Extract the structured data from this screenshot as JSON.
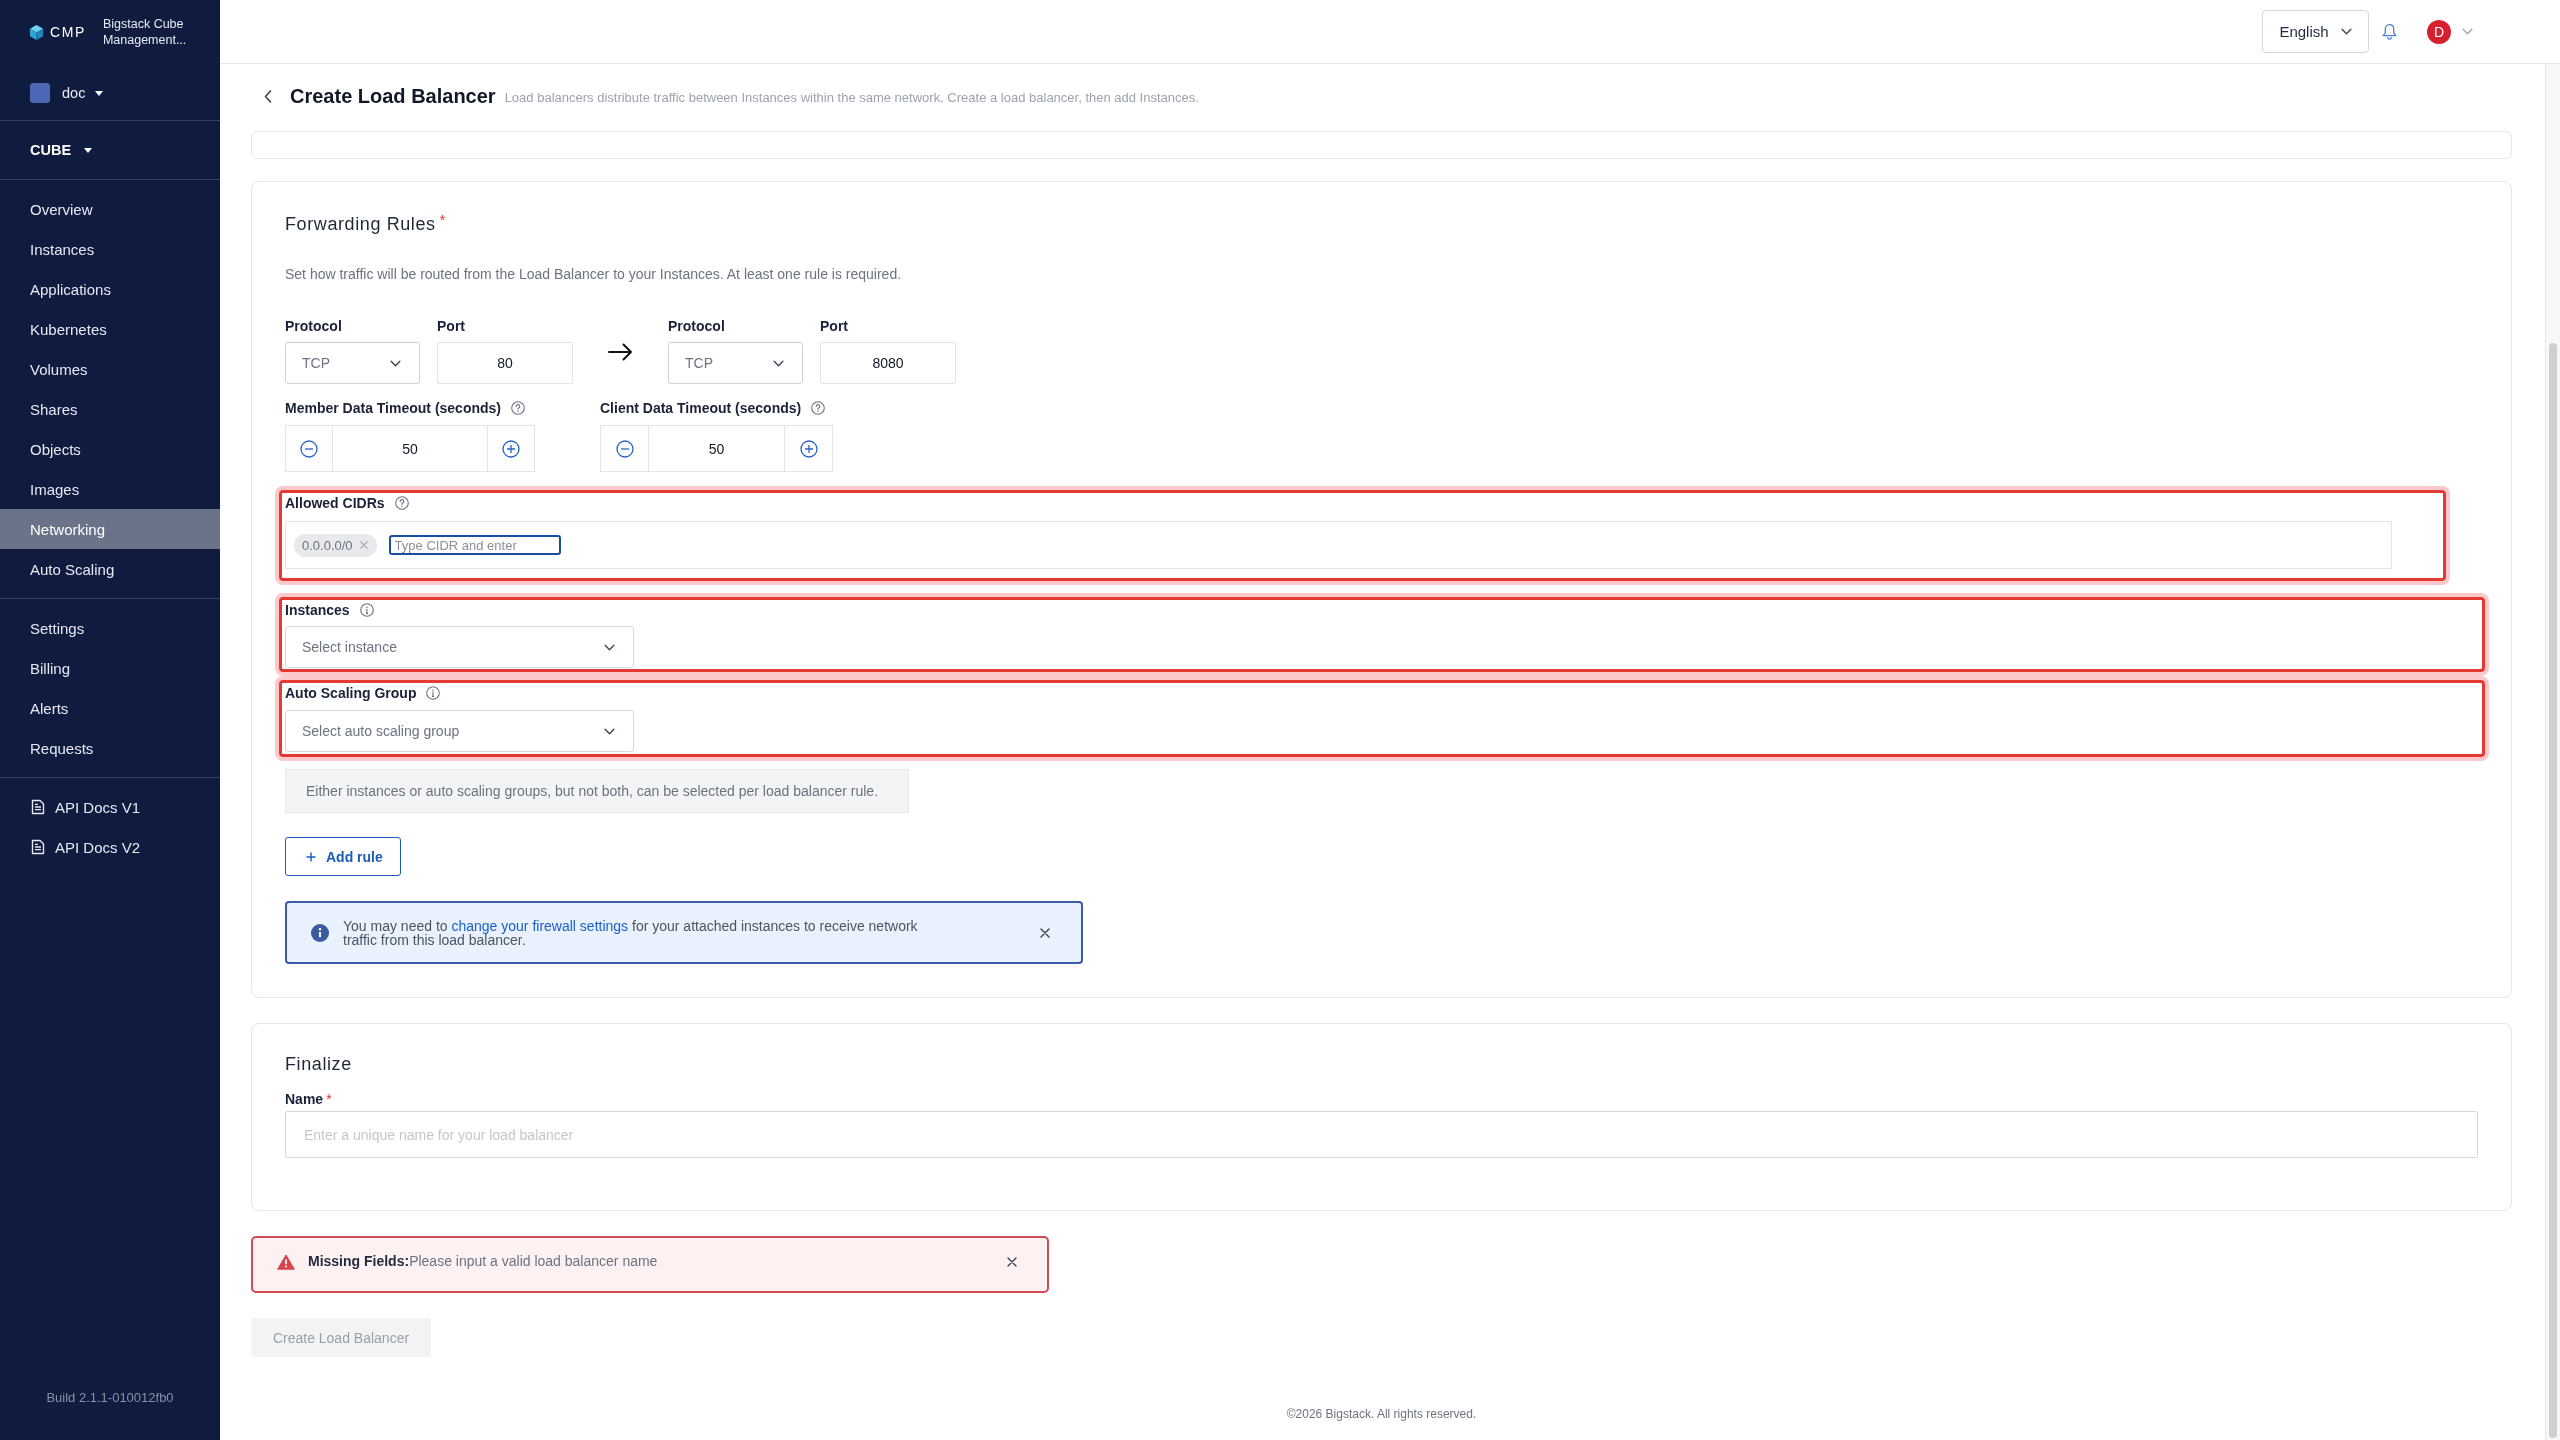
{
  "sidebar": {
    "logo": "CMP",
    "product": "Bigstack Cube Management...",
    "project": "doc",
    "region": "CUBE",
    "nav_groups": [
      {
        "items": [
          {
            "label": "Overview",
            "selected": false
          },
          {
            "label": "Instances",
            "selected": false
          },
          {
            "label": "Applications",
            "selected": false
          },
          {
            "label": "Kubernetes",
            "selected": false
          },
          {
            "label": "Volumes",
            "selected": false
          },
          {
            "label": "Shares",
            "selected": false
          },
          {
            "label": "Objects",
            "selected": false
          },
          {
            "label": "Images",
            "selected": false
          },
          {
            "label": "Networking",
            "selected": true
          },
          {
            "label": "Auto Scaling",
            "selected": false
          }
        ]
      },
      {
        "items": [
          {
            "label": "Settings",
            "selected": false
          },
          {
            "label": "Billing",
            "selected": false
          },
          {
            "label": "Alerts",
            "selected": false
          },
          {
            "label": "Requests",
            "selected": false
          }
        ]
      }
    ],
    "doc_links": [
      {
        "label": "API Docs V1",
        "selected": false
      },
      {
        "label": "API Docs V2",
        "selected": false
      }
    ],
    "build": "Build 2.1.1-010012fb0"
  },
  "header": {
    "language": "English",
    "avatar_initial": "D"
  },
  "page": {
    "title": "Create Load Balancer",
    "subtitle": "Load balancers distribute traffic between Instances within the same network. Create a load balancer, then add Instances."
  },
  "forwarding_rules": {
    "title": "Forwarding Rules",
    "required_mark": "*",
    "description": "Set how traffic will be routed from the Load Balancer to your Instances. At least one rule is required.",
    "endpoints": [
      {
        "protocol_label": "Protocol",
        "protocol": "TCP",
        "port_label": "Port",
        "port": "80"
      },
      {
        "protocol_label": "Protocol",
        "protocol": "TCP",
        "port_label": "Port",
        "port": "8080"
      }
    ],
    "timeouts": [
      {
        "label": "Member Data Timeout (seconds)",
        "value": "50"
      },
      {
        "label": "Client Data Timeout (seconds)",
        "value": "50"
      }
    ],
    "fields": [
      {
        "kind": "tags",
        "label": "Allowed CIDRs",
        "highlighted": true,
        "tags": [
          "0.0.0.0/0"
        ],
        "placeholder": "Type CIDR and enter",
        "focused": true
      },
      {
        "kind": "select",
        "label": "Instances",
        "highlighted": true,
        "placeholder": "Select instance"
      },
      {
        "kind": "select",
        "label": "Auto Scaling Group",
        "highlighted": true,
        "placeholder": "Select auto scaling group"
      }
    ],
    "note": "Either instances or auto scaling groups, but not both, can be selected per load balancer rule.",
    "add_rule": "Add rule",
    "notice": {
      "before": "You may need to ",
      "link": "change your firewall settings",
      "after": " for your attached instances to receive network traffic from this load balancer."
    }
  },
  "finalize": {
    "title": "Finalize",
    "name_label": "Name",
    "required_mark": "*",
    "name_placeholder": "Enter a unique name for your load balancer"
  },
  "error": {
    "message": "**Missing Fields:**Please input a valid load balancer name"
  },
  "submit": {
    "label": "Create Load Balancer",
    "disabled": true
  },
  "footer": "©2026 Bigstack. All rights reserved."
}
